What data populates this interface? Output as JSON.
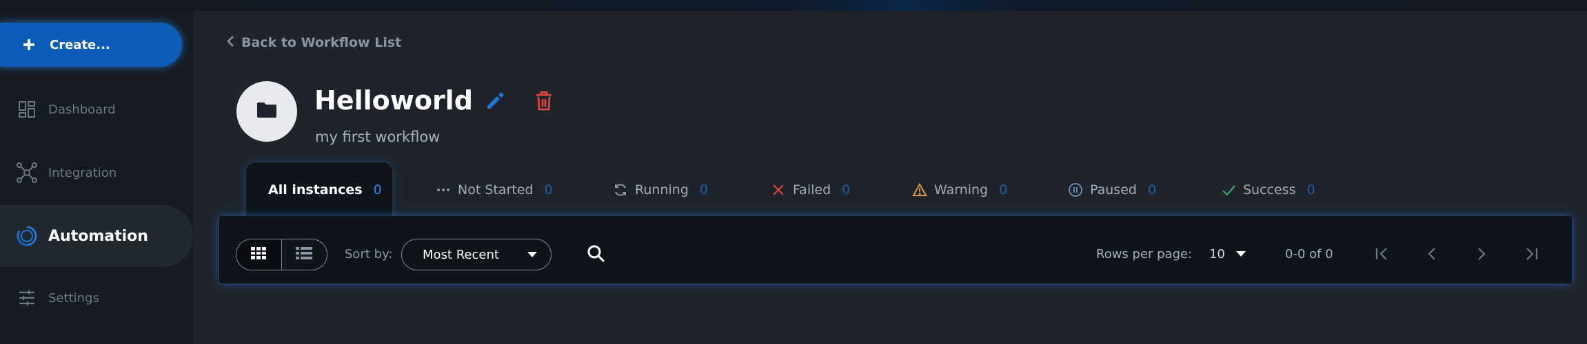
{
  "sidebar": {
    "create_label": "Create...",
    "items": [
      {
        "label": "Dashboard",
        "icon": "dashboard-icon",
        "active": false
      },
      {
        "label": "Integration",
        "icon": "integration-icon",
        "active": false
      },
      {
        "label": "Automation",
        "icon": "automation-icon",
        "active": true
      },
      {
        "label": "Settings",
        "icon": "settings-icon",
        "active": false
      }
    ]
  },
  "header": {
    "back_label": "Back to Workflow List",
    "title": "Helloworld",
    "description": "my first workflow",
    "folder_icon": "folder-icon",
    "edit_icon": "pencil-icon",
    "delete_icon": "trash-icon"
  },
  "tabs": [
    {
      "label": "All instances",
      "count": "0",
      "active": true
    },
    {
      "label": "Not Started",
      "count": "0",
      "icon": "dots-icon"
    },
    {
      "label": "Running",
      "count": "0",
      "icon": "refresh-icon"
    },
    {
      "label": "Failed",
      "count": "0",
      "icon": "x-icon"
    },
    {
      "label": "Warning",
      "count": "0",
      "icon": "warning-icon"
    },
    {
      "label": "Paused",
      "count": "0",
      "icon": "pause-icon"
    },
    {
      "label": "Success",
      "count": "0",
      "icon": "check-icon"
    }
  ],
  "toolbar": {
    "sort_label": "Sort by:",
    "sort_value": "Most Recent",
    "rows_per_page_label": "Rows per page:",
    "rows_per_page_value": "10",
    "range_text": "0-0 of 0"
  },
  "colors": {
    "accent": "#0d5cb8",
    "background": "#1f242c",
    "sidebar": "#161b22",
    "failed": "#e0463a",
    "warning": "#e8a23a",
    "success": "#3aa86a",
    "delete": "#e0463a",
    "edit": "#1e78d6"
  }
}
